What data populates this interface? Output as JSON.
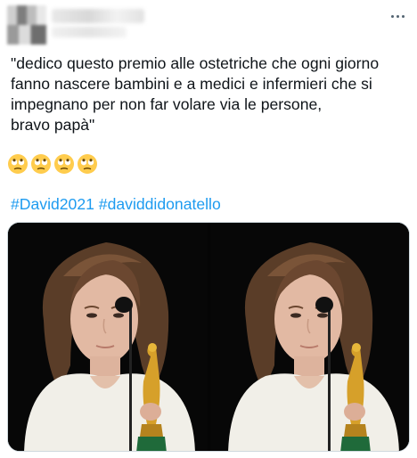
{
  "tweet": {
    "text_lines": [
      "\"dedico questo premio alle ostetriche che ogni giorno",
      "fanno nascere bambini e a medici e infermieri che si",
      "impegnano per non far volare via le persone,",
      "bravo papà\""
    ],
    "emojis": [
      "face-with-rolling-eyes",
      "face-with-rolling-eyes",
      "face-with-rolling-eyes",
      "face-with-rolling-eyes"
    ],
    "hashtags": [
      "#David2021",
      "#daviddidonatello"
    ]
  },
  "colors": {
    "text": "#0f1419",
    "link": "#1d9bf0",
    "secondary": "#536471",
    "media_background": "#050505"
  },
  "icons": {
    "more": "more-horizontal-icon"
  }
}
